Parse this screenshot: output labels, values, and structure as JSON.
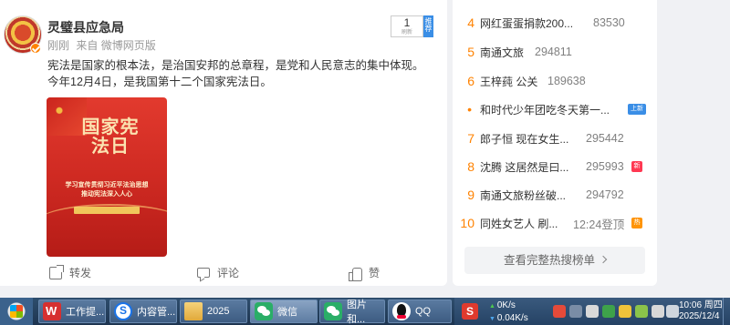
{
  "post": {
    "author": "灵璧县应急局",
    "meta_time": "刚刚",
    "meta_source": "来自 微博网页版",
    "feed_count": "1",
    "feed_count_label": "刷新",
    "feed_tab": "推荐",
    "content_line1": "宪法是国家的根本法，是治国安邦的总章程，是党和人民意志的集中体现。",
    "content_line2": "今年12月4日，是我国第十二个国家宪法日。",
    "poster": {
      "title": "国家宪法日",
      "slogan_line1": "学习宣传贯彻习近平法治思想",
      "slogan_line2": "推动宪法深入人心"
    },
    "actions": {
      "share": "转发",
      "comment": "评论",
      "like": "赞"
    }
  },
  "hot_list": {
    "items": [
      {
        "rank": "4",
        "title": "网红蛋蛋捐款200...",
        "count": "83530",
        "tag": ""
      },
      {
        "rank": "5",
        "title": "南通文旅",
        "count": "294811",
        "tag": ""
      },
      {
        "rank": "6",
        "title": "王梓莼 公关",
        "count": "189638",
        "tag": ""
      },
      {
        "rank": "•",
        "title": "和时代少年团吃冬天第一...",
        "count": "",
        "tag": "上新"
      },
      {
        "rank": "7",
        "title": "郎子恒 现在女生...",
        "count": "295442",
        "tag": ""
      },
      {
        "rank": "8",
        "title": "沈腾 这居然是曰...",
        "count": "295993",
        "tag": "新"
      },
      {
        "rank": "9",
        "title": "南通文旅粉丝破...",
        "count": "294792",
        "tag": ""
      },
      {
        "rank": "10",
        "title": "同姓女艺人 刷...",
        "count": "12:24登顶",
        "tag": "热"
      }
    ],
    "more_label": "查看完整热搜榜单"
  },
  "taskbar": {
    "buttons": [
      {
        "label": "工作提...",
        "icon": "wps-icon"
      },
      {
        "label": "内容管...",
        "icon": "sogou-browser-icon"
      },
      {
        "label": "2025",
        "icon": "folder-icon"
      },
      {
        "label": "微信",
        "icon": "wechat-icon"
      },
      {
        "label": "图片和...",
        "icon": "wechat-icon"
      },
      {
        "label": "QQ",
        "icon": "qq-icon"
      }
    ],
    "net_up": "0K/s",
    "net_down": "0.04K/s",
    "clock_time": "10:06 周四",
    "clock_date": "2025/12/4"
  },
  "colors": {
    "accent_orange": "#ff8200",
    "tag_new": "#ff3852",
    "tag_hot": "#ff9406",
    "tag_up": "#3a8ee6",
    "poster_red": "#cf2a22"
  }
}
